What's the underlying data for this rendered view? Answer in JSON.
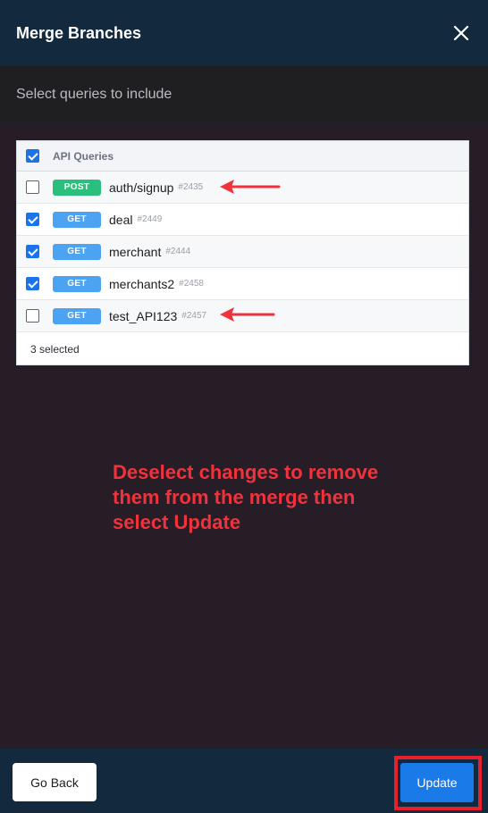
{
  "header": {
    "title": "Merge Branches"
  },
  "subheader": {
    "text": "Select queries to include"
  },
  "queries": {
    "header_label": "API Queries",
    "header_checked": true,
    "items": [
      {
        "method": "POST",
        "name": "auth/signup",
        "id": "#2435",
        "checked": false
      },
      {
        "method": "GET",
        "name": "deal",
        "id": "#2449",
        "checked": true
      },
      {
        "method": "GET",
        "name": "merchant",
        "id": "#2444",
        "checked": true
      },
      {
        "method": "GET",
        "name": "merchants2",
        "id": "#2458",
        "checked": true
      },
      {
        "method": "GET",
        "name": "test_API123",
        "id": "#2457",
        "checked": false
      }
    ],
    "selected_text": "3 selected"
  },
  "annotation": {
    "text": "Deselect changes to remove them from the merge then select Update"
  },
  "footer": {
    "go_back_label": "Go Back",
    "update_label": "Update"
  },
  "colors": {
    "header_bg": "#13293d",
    "post_badge": "#2bbf7d",
    "get_badge": "#4ba3f2",
    "checkbox_on": "#1a73e8",
    "annotation": "#f0323c",
    "update_button": "#1a7ae8"
  }
}
